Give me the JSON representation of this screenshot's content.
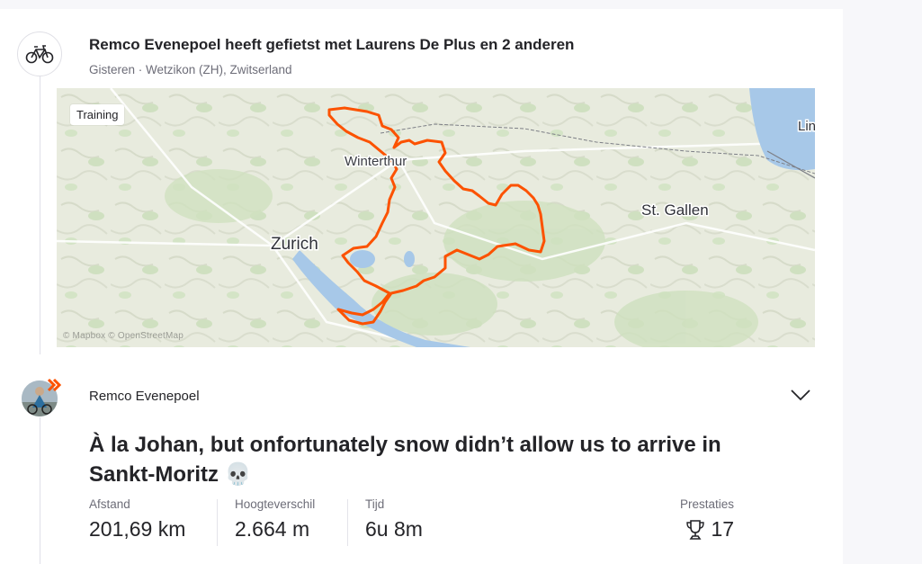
{
  "group_activity": {
    "title": "Remco Evenepoel heeft gefietst met Laurens De Plus en 2 anderen",
    "meta": "Gisteren · Wetzikon (ZH), Zwitserland",
    "icon": "bike-icon"
  },
  "map": {
    "badge": "Training",
    "labels": {
      "winterthur": "Winterthur",
      "zurich": "Zurich",
      "st_gallen": "St. Gallen",
      "lindau": "Lin"
    },
    "attribution": "© Mapbox  © OpenStreetMap",
    "route_color": "#fc5200"
  },
  "activity": {
    "athlete": "Remco Evenepoel",
    "title": "À la Johan, but onfortunately snow didn’t allow us to arrive in Sankt-Moritz",
    "emoji": "💀",
    "stats": [
      {
        "label": "Afstand",
        "value": "201,69 km"
      },
      {
        "label": "Hoogteverschil",
        "value": "2.664 m"
      },
      {
        "label": "Tijd",
        "value": "6u 8m"
      }
    ],
    "achievements": {
      "label": "Prestaties",
      "value": "17",
      "icon": "trophy-icon"
    }
  }
}
